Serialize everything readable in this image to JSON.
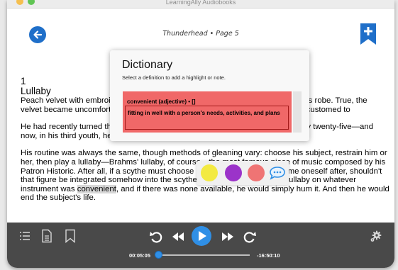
{
  "window": {
    "title": "LearningAlly Audiobooks"
  },
  "header": {
    "page_indicator": "Thunderhead • Page 5",
    "back_icon": "back-arrow-icon",
    "bookmark_icon": "add-bookmark-icon"
  },
  "content": {
    "chapter_number": "1",
    "chapter_title": "Lullaby",
    "paragraphs": [
      "Peach velvet with embroidered threads of gold; the scythe Thunderhead loved his robe. True, the velvet became uncomfortable in the heat, but it was something he had grown accustomed to",
      "He had recently turned the corner again, resetting his physical age back to a spry twenty-five—and now, in his third youth, he found his appetite for gleaning was stronger than ever."
    ],
    "para3_before": "His routine was always the same, though methods of gleaning vary: choose his subject, restrain him or her, then play a lullaby—Brahms' lullaby, of course—the most famous piece of music composed by his Patron Historic. After all, if a scythe must choose a figure from history to name oneself after, shouldn't that figure be integrated somehow into the scythes life? He would play the lullaby on whatever instrument was ",
    "para3_highlight": "convenient",
    "para3_after": ", and if there was none available, he would simply hum it. And then he would end the subject's life."
  },
  "dictionary": {
    "title": "Dictionary",
    "subtitle": "Select a definition to add a highlight or note.",
    "entry_word": "convenient (adjective) • []",
    "entry_definition": "fitting in well with a person's needs, activities, and plans"
  },
  "highlight_tray": {
    "colors": {
      "yellow": "#f3ea42",
      "purple": "#9b33c9",
      "red": "#ef7474"
    },
    "note_icon": "speech-bubble-icon"
  },
  "player": {
    "time_elapsed": "00:05:05",
    "time_remaining": "-16:50:10",
    "progress_fraction": 0.005,
    "accent_color": "#2f8fe6"
  }
}
